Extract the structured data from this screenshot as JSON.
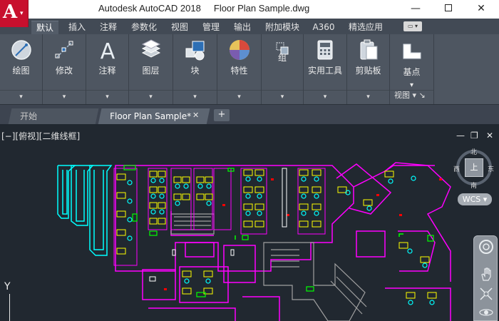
{
  "title_bar": {
    "app_letter": "A",
    "title": "Autodesk AutoCAD 2018     Floor Plan Sample.dwg",
    "minimize": "—",
    "close": "✕"
  },
  "ribbon_tabs": [
    "默认",
    "插入",
    "注释",
    "参数化",
    "视图",
    "管理",
    "输出",
    "附加模块",
    "A360",
    "精选应用"
  ],
  "ribbon_extra": "▭ ▾",
  "ribbon_groups": [
    {
      "label": "绘图",
      "icon": "draw-icon"
    },
    {
      "label": "修改",
      "icon": "modify-icon"
    },
    {
      "label": "注释",
      "icon": "annotation-icon"
    },
    {
      "label": "图层",
      "icon": "layers-icon"
    },
    {
      "label": "块",
      "icon": "block-icon"
    },
    {
      "label": "特性",
      "icon": "properties-icon"
    },
    {
      "label": "组",
      "icon": "group-icon"
    },
    {
      "label": "实用工具",
      "icon": "utilities-icon"
    },
    {
      "label": "剪贴板",
      "icon": "clipboard-icon"
    },
    {
      "label": "基点",
      "icon": "base-point-icon"
    }
  ],
  "view_panel_label": "视图",
  "dropdown_glyph": "▾",
  "file_tabs": {
    "home": "开始",
    "active": "Floor Plan Sample*",
    "close": "✕",
    "add": "+"
  },
  "viewport": {
    "label": "[−][俯视][二维线框]",
    "ctrl_min": "—",
    "ctrl_restore": "❐",
    "ctrl_close": "✕"
  },
  "viewcube": {
    "top": "上",
    "north": "北",
    "south": "南",
    "east": "东",
    "west": "西",
    "wcs": "WCS ▾"
  },
  "ucs": {
    "y_label": "Y"
  },
  "colors": {
    "background": "#212830",
    "ribbon": "#4e5661",
    "magenta": "#ff00ff",
    "cyan": "#00ffff",
    "yellow": "#ffff00",
    "green": "#00ff00",
    "red": "#ff0000",
    "white": "#ffffff",
    "gray": "#9a9a9a"
  }
}
